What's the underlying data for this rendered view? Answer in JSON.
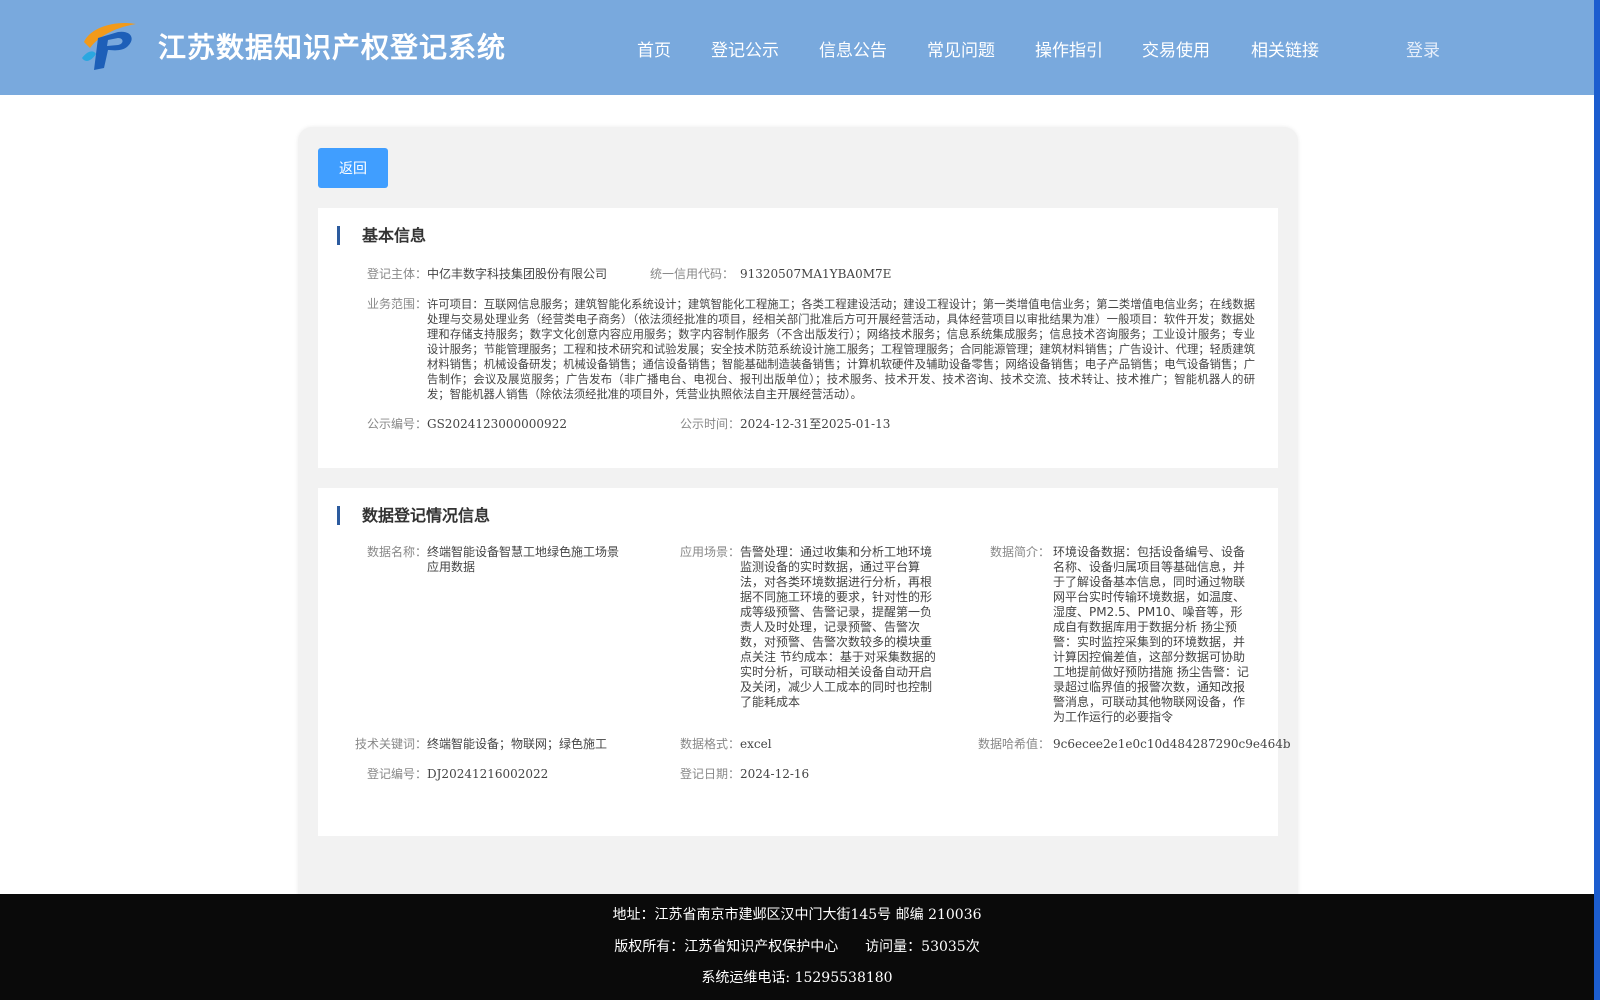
{
  "header": {
    "site_title": "江苏数据知识产权登记系统",
    "nav": [
      "首页",
      "登记公示",
      "信息公告",
      "常见问题",
      "操作指引",
      "交易使用",
      "相关链接"
    ],
    "login": "登录"
  },
  "colors": {
    "header_bg": "#79a9dd",
    "button": "#409eff",
    "footer_bg": "#0a0a0a",
    "accent_bar": "#2c5b9e"
  },
  "back_button": "返回",
  "basic_info": {
    "title": "基本信息",
    "subject_label": "登记主体：",
    "subject_value": "中亿丰数字科技集团股份有限公司",
    "credit_label": "统一信用代码：",
    "credit_value": "91320507MA1YBA0M7E",
    "scope_label": "业务范围：",
    "scope_value": "许可项目：互联网信息服务；建筑智能化系统设计；建筑智能化工程施工；各类工程建设活动；建设工程设计；第一类增值电信业务；第二类增值电信业务；在线数据处理与交易处理业务（经营类电子商务）（依法须经批准的项目，经相关部门批准后方可开展经营活动，具体经营项目以审批结果为准）一般项目：软件开发；数据处理和存储支持服务；数字文化创意内容应用服务；数字内容制作服务（不含出版发行）；网络技术服务；信息系统集成服务；信息技术咨询服务；工业设计服务；专业设计服务；节能管理服务；工程和技术研究和试验发展；安全技术防范系统设计施工服务；工程管理服务；合同能源管理；建筑材料销售；广告设计、代理；轻质建筑材料销售；机械设备研发；机械设备销售；通信设备销售；智能基础制造装备销售；计算机软硬件及辅助设备零售；网络设备销售；电子产品销售；电气设备销售；广告制作；会议及展览服务；广告发布（非广播电台、电视台、报刊出版单位）；技术服务、技术开发、技术咨询、技术交流、技术转让、技术推广；智能机器人的研发；智能机器人销售（除依法须经批准的项目外，凭营业执照依法自主开展经营活动）。",
    "notice_no_label": "公示编号：",
    "notice_no_value": "GS2024123000000922",
    "notice_time_label": "公示时间：",
    "notice_time_value": "2024-12-31至2025-01-13"
  },
  "data_info": {
    "title": "数据登记情况信息",
    "name_label": "数据名称：",
    "name_value": "终端智能设备智慧工地绿色施工场景应用数据",
    "scene_label": "应用场景：",
    "scene_value": "告警处理：通过收集和分析工地环境监测设备的实时数据，通过平台算法，对各类环境数据进行分析，再根据不同施工环境的要求，针对性的形成等级预警、告警记录，提醒第一负责人及时处理，记录预警、告警次数，对预警、告警次数较多的模块重点关注 节约成本：基于对采集数据的实时分析，可联动相关设备自动开启及关闭，减少人工成本的同时也控制了能耗成本",
    "intro_label": "数据简介：",
    "intro_value": "环境设备数据：包括设备编号、设备名称、设备归属项目等基础信息，并于了解设备基本信息，同时通过物联网平台实时传输环境数据，如温度、湿度、PM2.5、PM10、噪音等，形成自有数据库用于数据分析 扬尘预警：实时监控采集到的环境数据，并计算因控偏差值，这部分数据可协助工地提前做好预防措施 扬尘告警：记录超过临界值的报警次数，通知改报警消息，可联动其他物联网设备，作为工作运行的必要指令",
    "keyword_label": "技术关键词：",
    "keyword_value": "终端智能设备；物联网；绿色施工",
    "format_label": "数据格式：",
    "format_value": "excel",
    "hash_label": "数据哈希值：",
    "hash_value": "9c6ecee2e1e0c10d484287290c9e464b",
    "reg_no_label": "登记编号：",
    "reg_no_value": "DJ20241216002022",
    "reg_date_label": "登记日期：",
    "reg_date_value": "2024-12-16"
  },
  "footer": {
    "address": "地址：江苏省南京市建邺区汉中门大街145号 邮编 210036",
    "copyright": "版权所有：江苏省知识产权保护中心",
    "visits": "访问量：53035次",
    "phone": "系统运维电话: 15295538180"
  }
}
